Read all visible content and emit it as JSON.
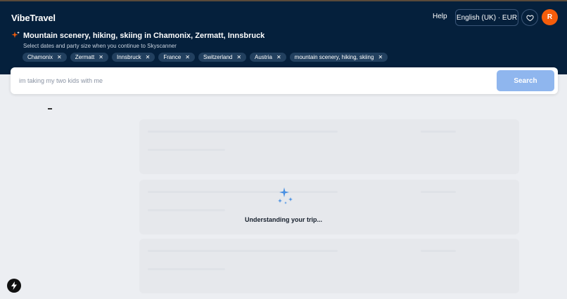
{
  "app": {
    "logo": "VibeTravel"
  },
  "header": {
    "help": "Help",
    "language": "English (UK) · EUR",
    "avatar_initial": "R",
    "favorites_icon": "heart-icon"
  },
  "trip": {
    "title": "Mountain scenery, hiking, skiing in Chamonix, Zermatt, Innsbruck",
    "subtitle": "Select dates and party size when you continue to Skyscanner",
    "chips": [
      {
        "label": "Chamonix"
      },
      {
        "label": "Zermatt"
      },
      {
        "label": "Innsbruck"
      },
      {
        "label": "France"
      },
      {
        "label": "Switzerland"
      },
      {
        "label": "Austria"
      },
      {
        "label": "mountain scenery, hiking, skiing"
      }
    ]
  },
  "search": {
    "placeholder": "im taking my two kids with me",
    "button_label": "Search"
  },
  "status": {
    "loading": "Understanding your trip..."
  },
  "colors": {
    "header_bg": "#05203c",
    "accent_orange": "#f55d0b",
    "search_button": "#8fb6ee",
    "sparkle_blue": "#4a90e2"
  }
}
